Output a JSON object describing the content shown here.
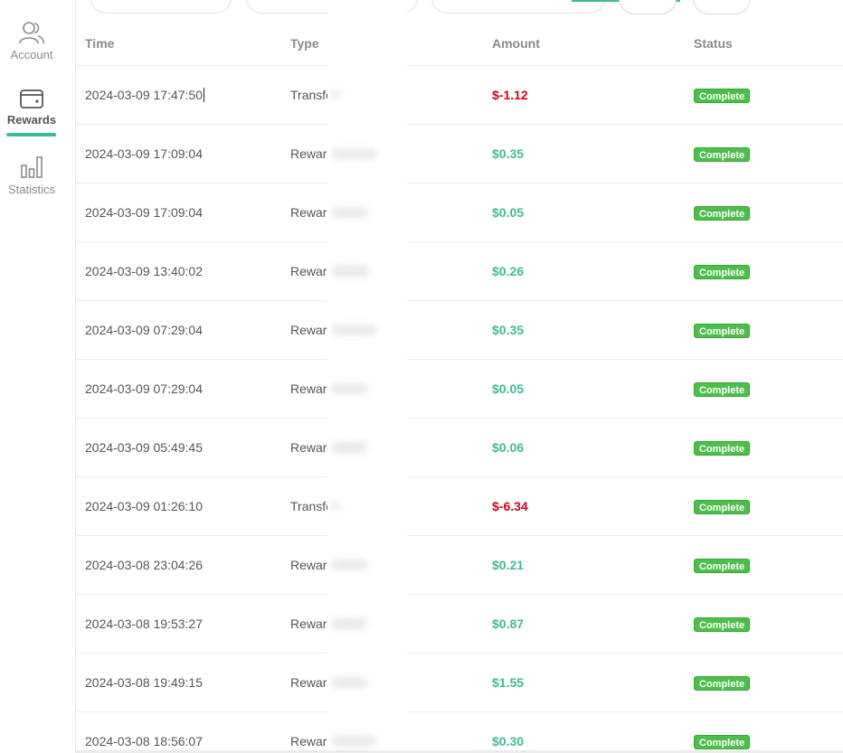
{
  "sidebar": {
    "items": [
      {
        "label": "Account",
        "icon": "user-group-icon",
        "active": false
      },
      {
        "label": "Rewards",
        "icon": "wallet-icon",
        "active": true
      },
      {
        "label": "Statistics",
        "icon": "bar-chart-icon",
        "active": false
      }
    ],
    "accent_color": "#3dbb99"
  },
  "table": {
    "headers": {
      "time": "Time",
      "type": "Type",
      "amount": "Amount",
      "status": "Status"
    },
    "rows": [
      {
        "time": "2024-03-09 17:47:50",
        "type": "Transfe",
        "amount": "$-1.12",
        "status": "Complete",
        "sign": "neg"
      },
      {
        "time": "2024-03-09 17:09:04",
        "type": "Reward",
        "amount": "$0.35",
        "status": "Complete",
        "sign": "pos"
      },
      {
        "time": "2024-03-09 17:09:04",
        "type": "Reward",
        "amount": "$0.05",
        "status": "Complete",
        "sign": "pos"
      },
      {
        "time": "2024-03-09 13:40:02",
        "type": "Reward",
        "amount": "$0.26",
        "status": "Complete",
        "sign": "pos"
      },
      {
        "time": "2024-03-09 07:29:04",
        "type": "Reward",
        "amount": "$0.35",
        "status": "Complete",
        "sign": "pos"
      },
      {
        "time": "2024-03-09 07:29:04",
        "type": "Reward",
        "amount": "$0.05",
        "status": "Complete",
        "sign": "pos"
      },
      {
        "time": "2024-03-09 05:49:45",
        "type": "Reward",
        "amount": "$0.06",
        "status": "Complete",
        "sign": "pos"
      },
      {
        "time": "2024-03-09 01:26:10",
        "type": "Transfe",
        "amount": "$-6.34",
        "status": "Complete",
        "sign": "neg"
      },
      {
        "time": "2024-03-08 23:04:26",
        "type": "Reward",
        "amount": "$0.21",
        "status": "Complete",
        "sign": "pos"
      },
      {
        "time": "2024-03-08 19:53:27",
        "type": "Reward",
        "amount": "$0.87",
        "status": "Complete",
        "sign": "pos"
      },
      {
        "time": "2024-03-08 19:49:15",
        "type": "Reward",
        "amount": "$1.55",
        "status": "Complete",
        "sign": "pos"
      },
      {
        "time": "2024-03-08 18:56:07",
        "type": "Reward",
        "amount": "$0.30",
        "status": "Complete",
        "sign": "pos"
      }
    ]
  },
  "colors": {
    "positive": "#3dbb99",
    "negative": "#d0021b",
    "badge": "#4cbf4a"
  }
}
